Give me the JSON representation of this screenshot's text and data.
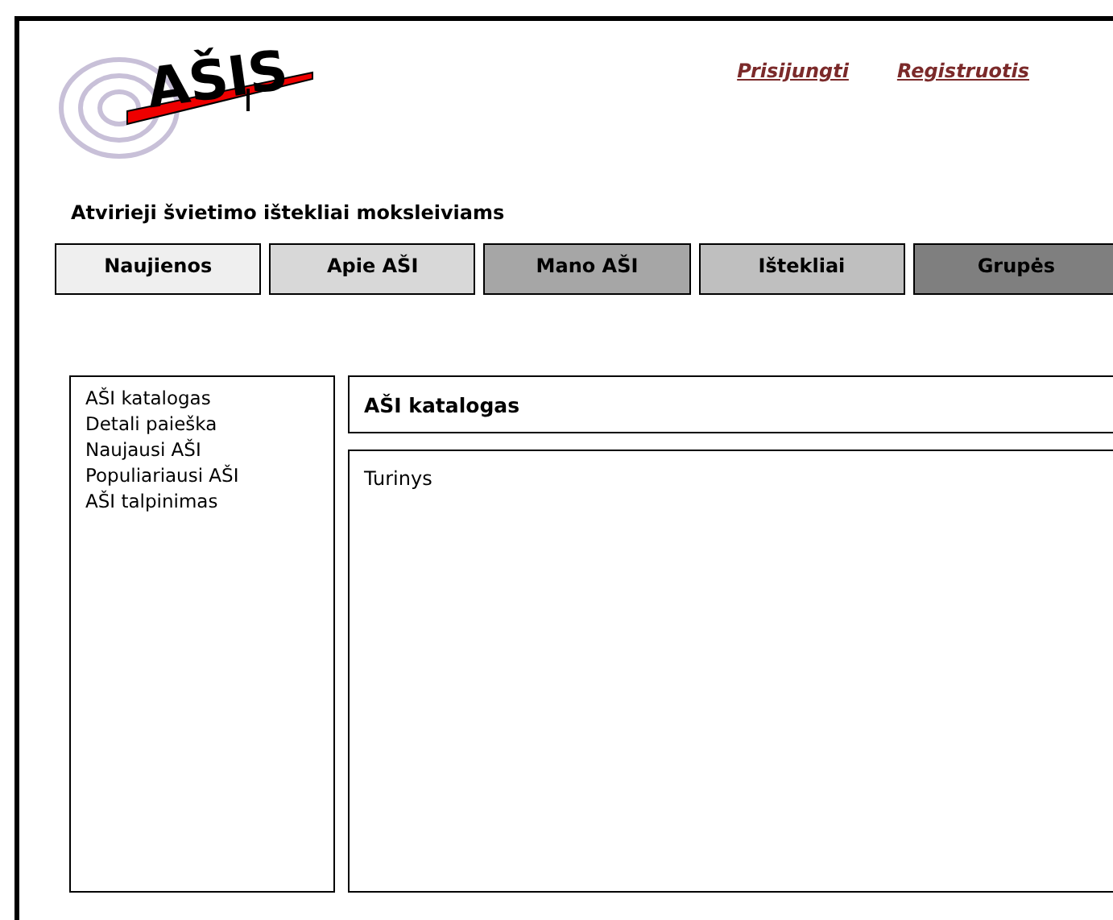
{
  "logo": {
    "text": "AŠIS"
  },
  "tagline": "Atvirieji švietimo ištekliai moksleiviams",
  "header_links": [
    "Prisijungti",
    "Registruotis"
  ],
  "tabs": [
    {
      "label": "Naujienos",
      "color": "#efefef"
    },
    {
      "label": "Apie AŠI",
      "color": "#d8d8d8"
    },
    {
      "label": "Mano AŠI",
      "color": "#a6a6a6"
    },
    {
      "label": "Ištekliai",
      "color": "#bfbfbf"
    },
    {
      "label": "Grupės",
      "color": "#7f7f7f"
    }
  ],
  "sidebar": {
    "items": [
      "AŠI katalogas",
      "Detali paieška",
      "Naujausi AŠI",
      "Populiariausi AŠI",
      "AŠI talpinimas"
    ]
  },
  "page_title": "AŠI katalogas",
  "content": {
    "text": "Turinys"
  }
}
